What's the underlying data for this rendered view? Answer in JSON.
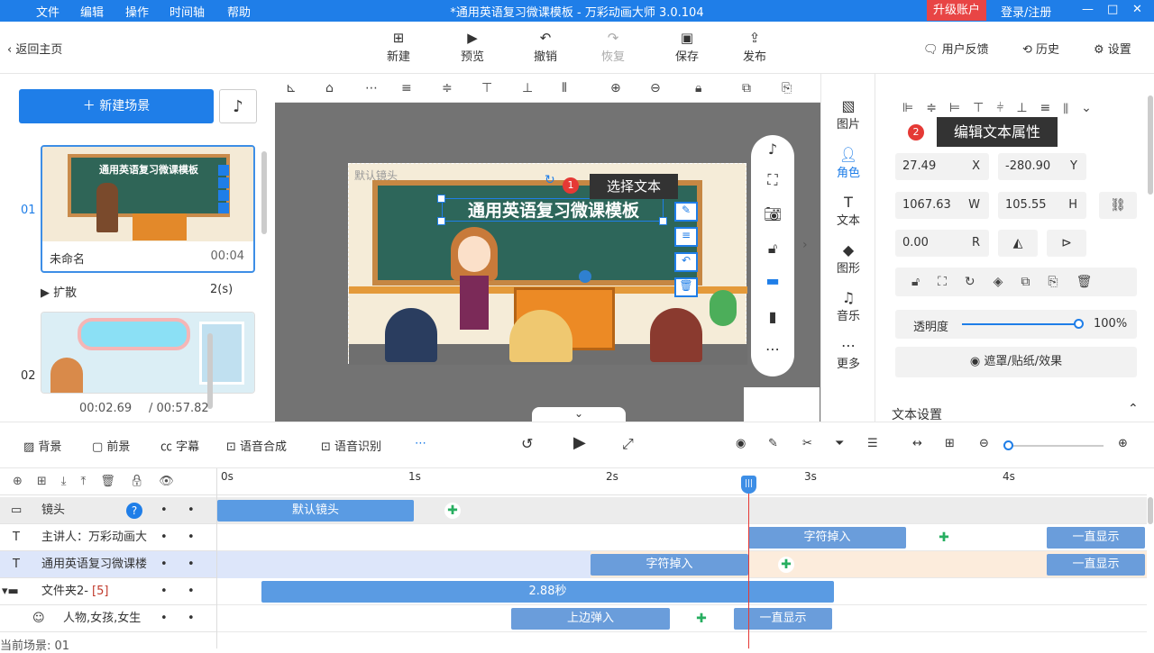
{
  "menu": [
    "文件",
    "编辑",
    "操作",
    "时间轴",
    "帮助"
  ],
  "window_title": "*通用英语复习微课模板 - 万彩动画大师 3.0.104",
  "upgrade_label": "升级账户",
  "login_label": "登录/注册",
  "back_label": "返回主页",
  "toolbar": {
    "new": "新建",
    "preview": "预览",
    "undo": "撤销",
    "redo": "恢复",
    "save": "保存",
    "publish": "发布",
    "feedback": "用户反馈",
    "history": "历史",
    "settings": "设置"
  },
  "left": {
    "new_scene": "新建场景",
    "scenes": [
      {
        "num": "01",
        "name": "未命名",
        "duration": "00:04",
        "thumb_title": "通用英语复习微课模板",
        "transition": "扩散",
        "transition_time": "2(s)"
      },
      {
        "num": "02"
      }
    ],
    "time_current": "00:02.69",
    "time_total": "/ 00:57.82"
  },
  "canvas": {
    "default_camera_label": "默认镜头",
    "title_text": "通用英语复习微课模板",
    "callout1_num": "1",
    "callout1_text": "选择文本"
  },
  "side_icons": [
    "图片",
    "角色",
    "文本",
    "图形",
    "音乐",
    "更多"
  ],
  "right": {
    "callout2_num": "2",
    "callout2_text": "编辑文本属性",
    "x": "27.49",
    "x_unit": "X",
    "y": "-280.90",
    "y_unit": "Y",
    "w": "1067.63",
    "w_unit": "W",
    "h": "105.55",
    "h_unit": "H",
    "r": "0.00",
    "r_unit": "R",
    "opacity_label": "透明度",
    "opacity_value": "100%",
    "opacity_level": 1.0,
    "mask_label": "遮罩/贴纸/效果",
    "text_settings": "文本设置"
  },
  "bottom_tools": [
    "背景",
    "前景",
    "字幕",
    "语音合成",
    "语音识别"
  ],
  "timeline": {
    "ticks": [
      "0s",
      "1s",
      "2s",
      "3s",
      "4s"
    ],
    "rows": [
      {
        "label": "镜头"
      },
      {
        "label": "主讲人：万彩动画大"
      },
      {
        "label": "通用英语复习微课楼"
      },
      {
        "label": "文件夹2-",
        "count": "[5]"
      },
      {
        "label": "人物,女孩,女生"
      }
    ],
    "clips": {
      "camera": "默认镜头",
      "presenter_in": "字符掉入",
      "presenter_show": "一直显示",
      "title_in": "字符掉入",
      "title_show": "一直显示",
      "folder": "2.88秒",
      "person_in": "上边弹入",
      "person_show": "一直显示"
    },
    "current_scene": "当前场景: 01"
  }
}
